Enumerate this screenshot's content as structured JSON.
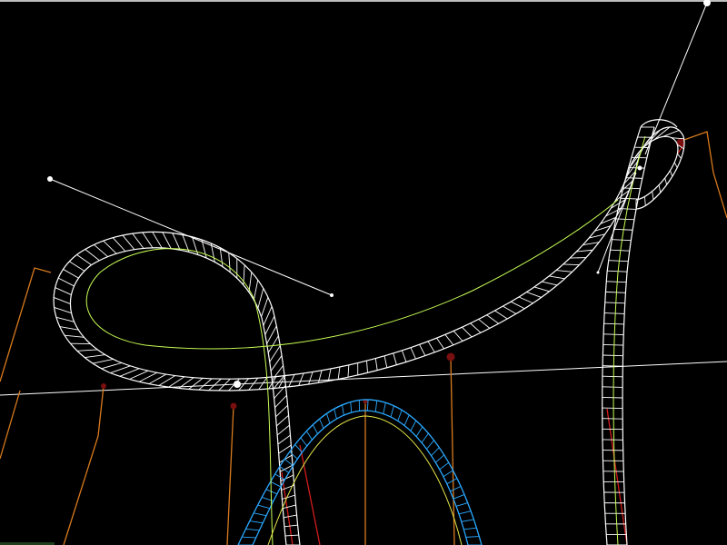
{
  "viewport": {
    "background": "#000000",
    "top_border_color": "#bdbdbd"
  },
  "colors": {
    "track_wire": "#ffffff",
    "track_selected": "#2aa8ff",
    "spine": "#c8ff55",
    "spine_alt": "#e6e64a",
    "support": "#d87a1e",
    "support_red": "#d21b1b",
    "support_node": "#7a0f0f",
    "handle": "#ffffff",
    "ground_line": "#ffffff"
  },
  "icons": {
    "control_point": "control-point-icon",
    "support_node": "support-node-icon"
  }
}
